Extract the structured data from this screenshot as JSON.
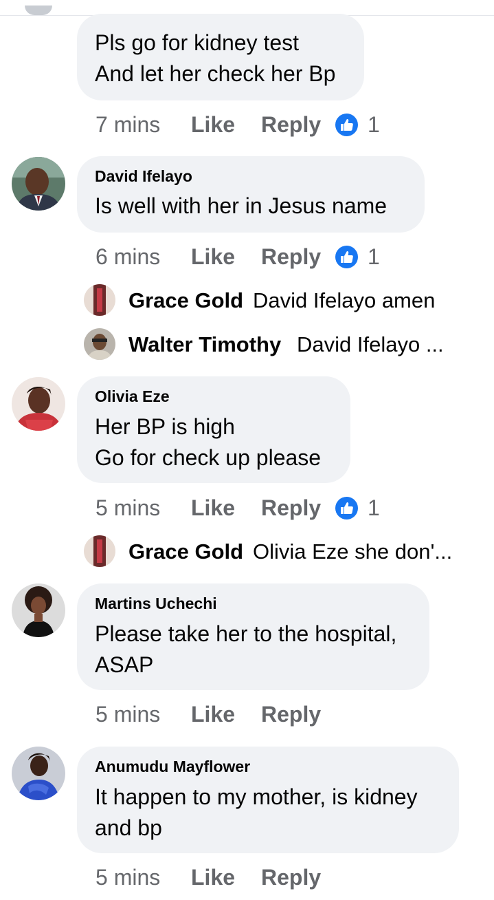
{
  "comments": [
    {
      "author": "",
      "lines": [
        "Pls go for kidney test",
        "And let her check her Bp"
      ],
      "time": "7 mins",
      "like_label": "Like",
      "reply_label": "Reply",
      "like_count": "1"
    },
    {
      "author": "David Ifelayo",
      "lines": [
        "Is well with her in Jesus name"
      ],
      "time": "6 mins",
      "like_label": "Like",
      "reply_label": "Reply",
      "like_count": "1",
      "replies": [
        {
          "author": "Grace Gold",
          "text": "David Ifelayo amen"
        },
        {
          "author": "Walter Timothy",
          "text": "David Ifelayo ..."
        }
      ]
    },
    {
      "author": "Olivia Eze",
      "lines": [
        "Her BP is high",
        "Go for check up please"
      ],
      "time": "5 mins",
      "like_label": "Like",
      "reply_label": "Reply",
      "like_count": "1",
      "replies": [
        {
          "author": "Grace Gold",
          "text": "Olivia Eze she don'..."
        }
      ]
    },
    {
      "author": "Martins Uchechi",
      "lines": [
        "Please take her to the hospital,",
        "ASAP"
      ],
      "time": "5 mins",
      "like_label": "Like",
      "reply_label": "Reply"
    },
    {
      "author": "Anumudu Mayflower",
      "lines": [
        "It happen to my mother,  is kidney",
        "and bp"
      ],
      "time": "5 mins",
      "like_label": "Like",
      "reply_label": "Reply"
    }
  ],
  "colors": {
    "bubble": "#f0f2f5",
    "meta_text": "#65676b",
    "like_blue": "#1877f2",
    "name_text": "#050505"
  },
  "icons": {
    "like_reaction": "thumbs-up-icon"
  }
}
